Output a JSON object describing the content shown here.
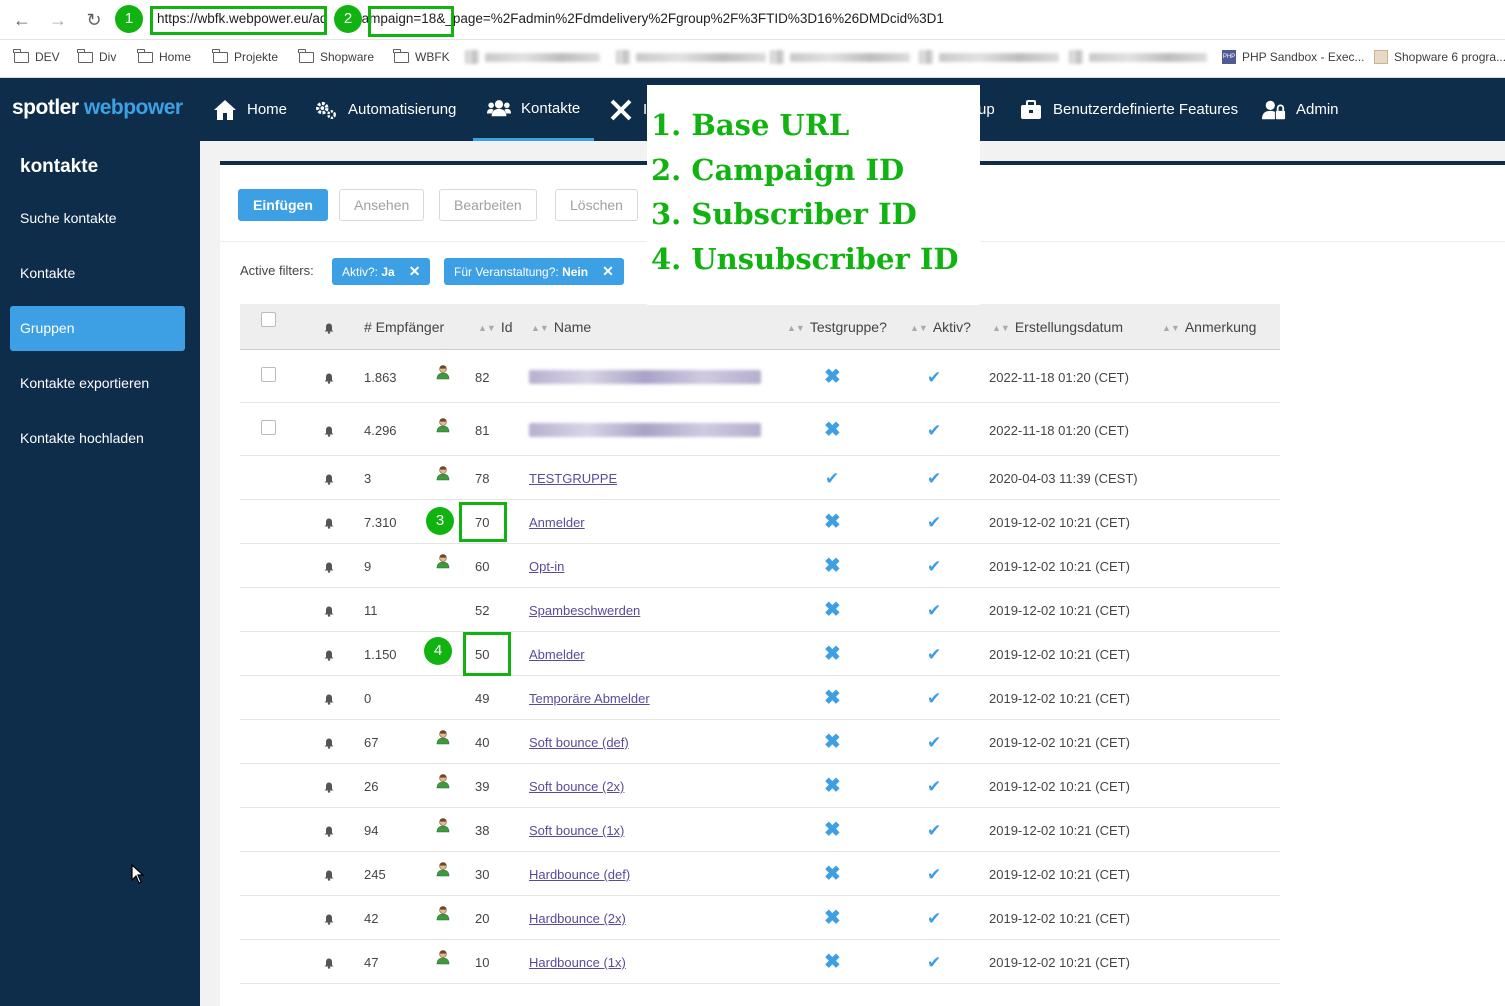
{
  "browser": {
    "url_host": "https://wbfk.webpower.eu/",
    "url_mid": "ad",
    "url_query": "?campaign=18",
    "url_rest": "&_page=%2Fadmin%2Fdmdelivery%2Fgroup%2F%3FTID%3D16%26DMDcid%3D1",
    "bookmarks": [
      {
        "label": "DEV",
        "icon": "folder-icon"
      },
      {
        "label": "Div",
        "icon": "folder-icon"
      },
      {
        "label": "Home",
        "icon": "folder-icon"
      },
      {
        "label": "Projekte",
        "icon": "folder-icon"
      },
      {
        "label": "Shopware",
        "icon": "folder-icon"
      },
      {
        "label": "WBFK",
        "icon": "folder-icon"
      },
      {
        "label": "PHP Sandbox - Exec...",
        "icon": "php-favicon"
      },
      {
        "label": "Shopware 6 progra...",
        "icon": "shopware-favicon"
      }
    ]
  },
  "header": {
    "logo_part1": "spotler",
    "logo_part2": "webpower",
    "nav": [
      {
        "label": "Home",
        "icon": "home-icon"
      },
      {
        "label": "Automatisierung",
        "icon": "gears-icon"
      },
      {
        "label": "Kontakte",
        "icon": "users-icon",
        "active": true
      },
      {
        "label": "I",
        "icon": "tools-icon"
      },
      {
        "label": "up",
        "icon": ""
      },
      {
        "label": "Benutzerdefinierte Features",
        "icon": "briefcase-icon"
      },
      {
        "label": "Admin",
        "icon": "user-lock-icon"
      }
    ]
  },
  "sidebar": {
    "title": "kontakte",
    "items": [
      {
        "label": "Suche kontakte"
      },
      {
        "label": "Kontakte"
      },
      {
        "label": "Gruppen",
        "active": true
      },
      {
        "label": "Kontakte exportieren"
      },
      {
        "label": "Kontakte hochladen"
      }
    ]
  },
  "toolbar": {
    "insert": "Einfügen",
    "view": "Ansehen",
    "edit": "Bearbeiten",
    "delete": "Löschen"
  },
  "filters": {
    "label": "Active filters:",
    "chip1_key": "Aktiv?:",
    "chip1_val": "Ja",
    "chip2_key": "Für Veranstaltung?:",
    "chip2_val": "Nein",
    "remove": "✕"
  },
  "table": {
    "headers": {
      "recipients": "# Empfänger",
      "id": "Id",
      "name": "Name",
      "testgroup": "Testgruppe?",
      "active": "Aktiv?",
      "created": "Erstellungsdatum",
      "note": "Anmerkung"
    },
    "rows": [
      {
        "recipients": "1.863",
        "person": true,
        "id": "82",
        "name": "",
        "redacted": true,
        "checkbox": true,
        "testgroup": false,
        "active": true,
        "created": "2022-11-18 01:20 (CET)"
      },
      {
        "recipients": "4.296",
        "person": true,
        "id": "81",
        "name": "",
        "redacted": true,
        "checkbox": true,
        "testgroup": false,
        "active": true,
        "created": "2022-11-18 01:20 (CET)"
      },
      {
        "recipients": "3",
        "person": true,
        "id": "78",
        "name": "TESTGRUPPE",
        "testgroup": true,
        "active": true,
        "created": "2020-04-03 11:39 (CEST)"
      },
      {
        "recipients": "7.310",
        "person": false,
        "id": "70",
        "name": "Anmelder",
        "testgroup": false,
        "active": true,
        "created": "2019-12-02 10:21 (CET)"
      },
      {
        "recipients": "9",
        "person": true,
        "id": "60",
        "name": "Opt-in",
        "testgroup": false,
        "active": true,
        "created": "2019-12-02 10:21 (CET)"
      },
      {
        "recipients": "11",
        "person": false,
        "id": "52",
        "name": "Spambeschwerden",
        "testgroup": false,
        "active": true,
        "created": "2019-12-02 10:21 (CET)"
      },
      {
        "recipients": "1.150",
        "person": false,
        "id": "50",
        "name": "Abmelder",
        "testgroup": false,
        "active": true,
        "created": "2019-12-02 10:21 (CET)"
      },
      {
        "recipients": "0",
        "person": false,
        "id": "49",
        "name": "Temporäre Abmelder",
        "testgroup": false,
        "active": true,
        "created": "2019-12-02 10:21 (CET)"
      },
      {
        "recipients": "67",
        "person": true,
        "id": "40",
        "name": "Soft bounce (def)",
        "testgroup": false,
        "active": true,
        "created": "2019-12-02 10:21 (CET)"
      },
      {
        "recipients": "26",
        "person": true,
        "id": "39",
        "name": "Soft bounce (2x)",
        "testgroup": false,
        "active": true,
        "created": "2019-12-02 10:21 (CET)"
      },
      {
        "recipients": "94",
        "person": true,
        "id": "38",
        "name": "Soft bounce (1x)",
        "testgroup": false,
        "active": true,
        "created": "2019-12-02 10:21 (CET)"
      },
      {
        "recipients": "245",
        "person": true,
        "id": "30",
        "name": "Hardbounce (def)",
        "testgroup": false,
        "active": true,
        "created": "2019-12-02 10:21 (CET)"
      },
      {
        "recipients": "42",
        "person": true,
        "id": "20",
        "name": "Hardbounce (2x)",
        "testgroup": false,
        "active": true,
        "created": "2019-12-02 10:21 (CET)"
      },
      {
        "recipients": "47",
        "person": true,
        "id": "10",
        "name": "Hardbounce (1x)",
        "testgroup": false,
        "active": true,
        "created": "2019-12-02 10:21 (CET)"
      }
    ]
  },
  "annotations": {
    "markers": [
      "1",
      "2",
      "3",
      "4"
    ],
    "legend": [
      "1. Base URL",
      "2. Campaign ID",
      "3. Subscriber ID",
      "4. Unsubscriber ID"
    ],
    "color": "#11b311"
  },
  "colors": {
    "nav_bg": "#0d2d4a",
    "accent": "#3ea0e4",
    "link": "#5a4a9e",
    "annotation": "#11b311"
  }
}
